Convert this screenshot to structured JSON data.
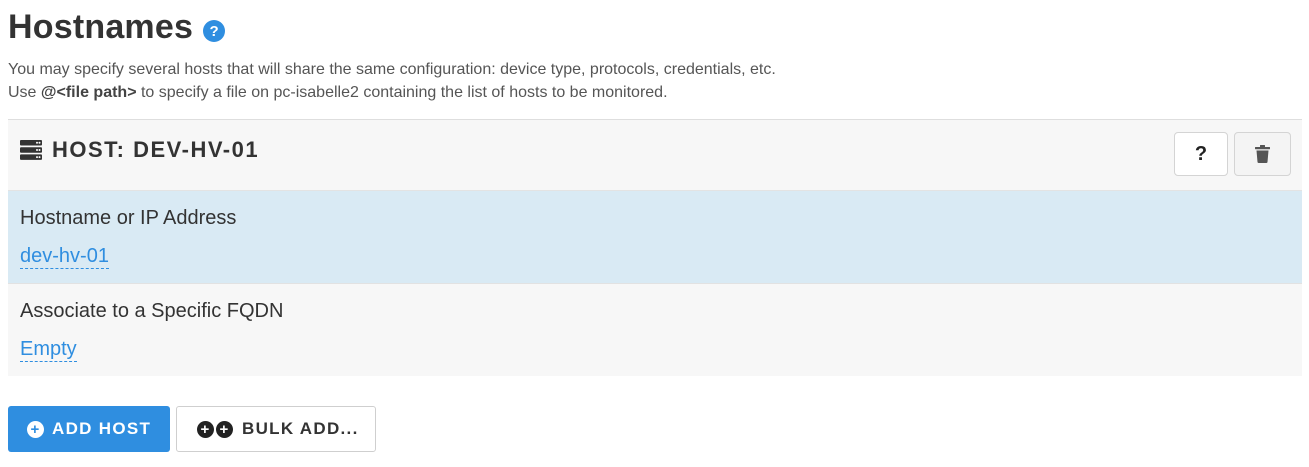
{
  "header": {
    "title": "Hostnames",
    "help_glyph": "?",
    "desc_line1": "You may specify several hosts that will share the same configuration: device type, protocols, credentials, etc.",
    "desc_line2_prefix": "Use",
    "desc_line2_highlight": "@<file path>",
    "desc_line2_suffix": "to specify a file on pc-isabelle2 containing the list of hosts to be monitored."
  },
  "host_panel": {
    "icon": "server-icon",
    "title": "HOST: DEV-HV-01",
    "help_button_label": "?",
    "delete_icon": "trash-icon"
  },
  "fields": [
    {
      "label": "Hostname or IP Address",
      "value": "dev-hv-01"
    },
    {
      "label": "Associate to a Specific FQDN",
      "value": "Empty"
    }
  ],
  "actions": {
    "add_host_label": "ADD HOST",
    "bulk_add_label": "BULK ADD...",
    "plus_glyph": "+"
  },
  "colors": {
    "accent": "#2f8ee0",
    "selected_row": "#d9eaf4",
    "panel_bg": "#f7f7f7"
  }
}
